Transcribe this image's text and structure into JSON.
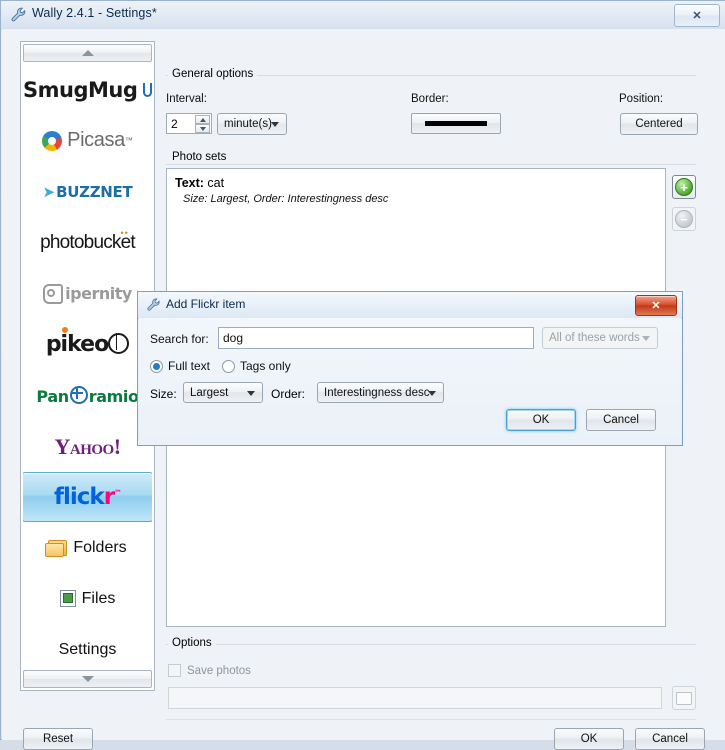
{
  "window": {
    "title": "Wally 2.4.1 - Settings*",
    "icon": "wrench-icon",
    "close_label": "✕"
  },
  "sidebar": {
    "scroll_up": "scroll-up-arrow",
    "scroll_down": "scroll-down-arrow",
    "items": [
      {
        "id": "smugmug",
        "label": "SmugMug",
        "selected": false
      },
      {
        "id": "picasa",
        "label": "Picasa",
        "selected": false
      },
      {
        "id": "buzznet",
        "label": "BUZZNET",
        "selected": false
      },
      {
        "id": "photobucket",
        "label": "photobucket",
        "selected": false
      },
      {
        "id": "ipernity",
        "label": "ipernity",
        "selected": false
      },
      {
        "id": "pikeo",
        "label": "pikeo",
        "selected": false
      },
      {
        "id": "panoramio",
        "label": "Panoramio",
        "selected": false
      },
      {
        "id": "yahoo",
        "label": "Yahoo!",
        "selected": false
      },
      {
        "id": "flickr",
        "label": "flickr",
        "selected": true
      },
      {
        "id": "folders",
        "label": "Folders",
        "selected": false
      },
      {
        "id": "files",
        "label": "Files",
        "selected": false
      },
      {
        "id": "settings",
        "label": "Settings",
        "selected": false
      }
    ]
  },
  "general_options": {
    "group_title": "General options",
    "interval_label": "Interval:",
    "interval_value": "2",
    "interval_unit": "minute(s)",
    "border_label": "Border:",
    "border_value": "",
    "position_label": "Position:",
    "position_value": "Centered"
  },
  "photo_sets": {
    "group_title": "Photo sets",
    "items": [
      {
        "prefix": "Text:",
        "text": "cat",
        "details": "Size: Largest,  Order: Interestingness desc"
      }
    ],
    "add_button": "+",
    "remove_button": "−"
  },
  "options": {
    "group_title": "Options",
    "save_photos_label": "Save photos",
    "save_photos_checked": false,
    "path_value": "",
    "browse_button": "folder-browse-icon"
  },
  "footer": {
    "reset_label": "Reset",
    "ok_label": "OK",
    "cancel_label": "Cancel"
  },
  "dialog": {
    "title": "Add Flickr item",
    "icon": "wrench-icon",
    "close_label": "✕",
    "search_label": "Search for:",
    "search_value": "dog",
    "search_placeholder": "",
    "match_mode": "All of these words",
    "match_mode_disabled": true,
    "radio_full_text": "Full text",
    "radio_tags_only": "Tags only",
    "radio_selected": "full_text",
    "size_label": "Size:",
    "size_value": "Largest",
    "order_label": "Order:",
    "order_value": "Interestingness desc",
    "ok_label": "OK",
    "cancel_label": "Cancel"
  },
  "colors": {
    "accent": "#1e7ec8",
    "selection": "#8ecdee",
    "close_red": "#c23a18",
    "flickr_blue": "#0063dc",
    "flickr_pink": "#ff0084"
  }
}
